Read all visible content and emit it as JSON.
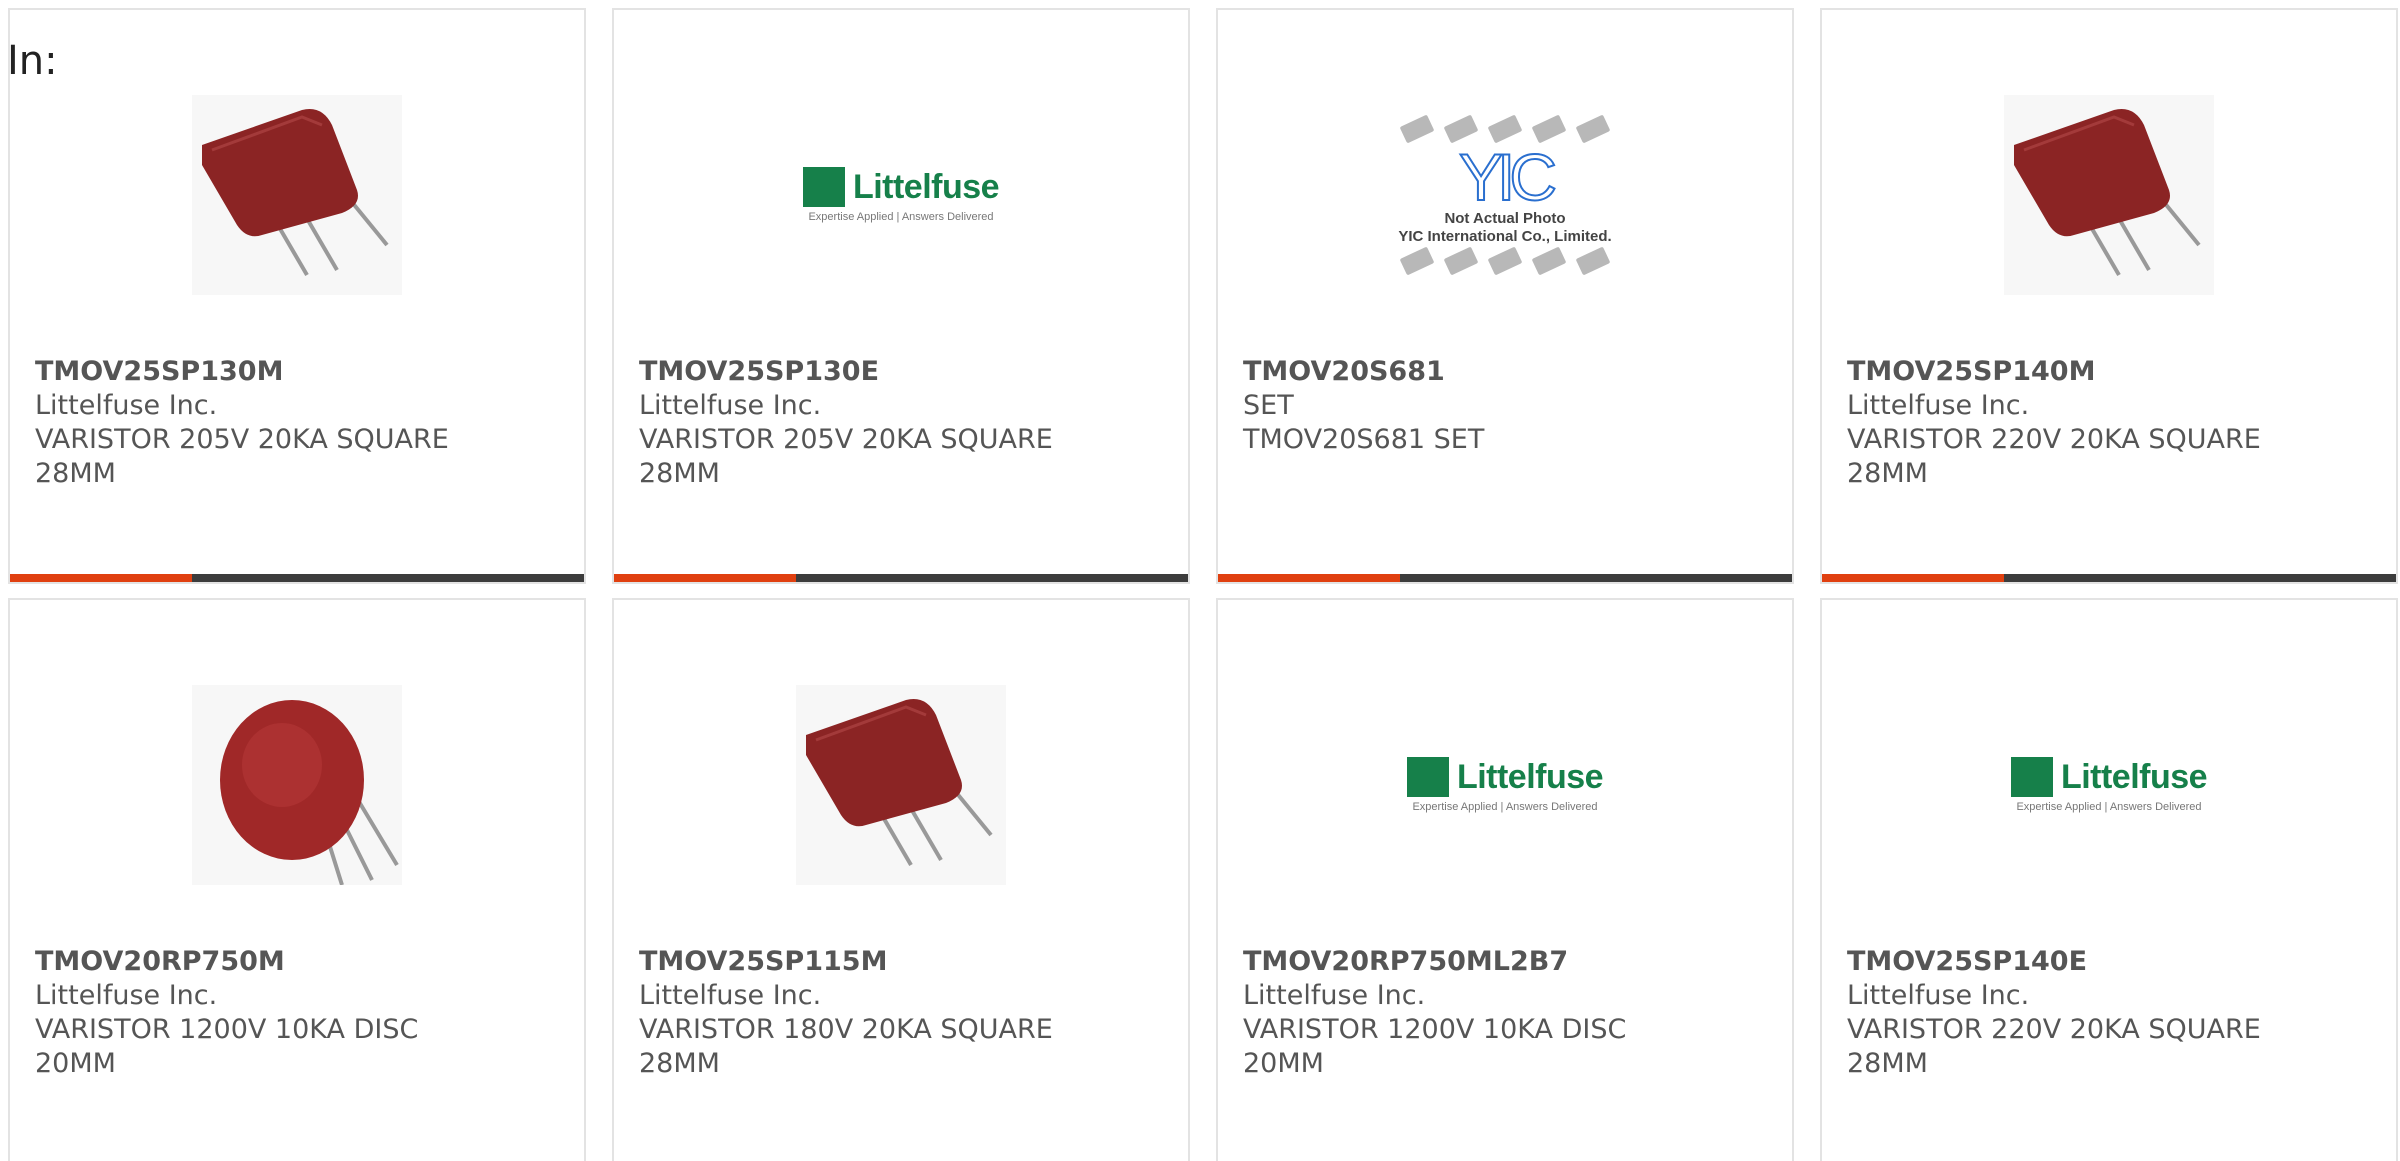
{
  "header": {
    "label": "In:"
  },
  "colors": {
    "accent": "#e04010",
    "bar": "#3c3c3c",
    "brand_green": "#16804a",
    "varistor": "#8b2424"
  },
  "products": [
    {
      "part_number": "TMOV25SP130M",
      "manufacturer": "Littelfuse Inc.",
      "desc_line1": "VARISTOR 205V 20KA SQUARE",
      "desc_line2": "28MM",
      "image": "square-varistor-photo"
    },
    {
      "part_number": "TMOV25SP130E",
      "manufacturer": "Littelfuse Inc.",
      "desc_line1": "VARISTOR 205V 20KA SQUARE",
      "desc_line2": "28MM",
      "image": "littelfuse-logo"
    },
    {
      "part_number": "TMOV20S681",
      "manufacturer": "SET",
      "desc_line1": "TMOV20S681 SET",
      "desc_line2": "",
      "image": "yic-placeholder"
    },
    {
      "part_number": "TMOV25SP140M",
      "manufacturer": "Littelfuse Inc.",
      "desc_line1": "VARISTOR 220V 20KA SQUARE",
      "desc_line2": "28MM",
      "image": "square-varistor-photo"
    },
    {
      "part_number": "TMOV20RP750M",
      "manufacturer": "Littelfuse Inc.",
      "desc_line1": "VARISTOR 1200V 10KA DISC",
      "desc_line2": "20MM",
      "image": "disc-varistor-photo"
    },
    {
      "part_number": "TMOV25SP115M",
      "manufacturer": "Littelfuse Inc.",
      "desc_line1": "VARISTOR 180V 20KA SQUARE",
      "desc_line2": "28MM",
      "image": "square-varistor-photo"
    },
    {
      "part_number": "TMOV20RP750ML2B7",
      "manufacturer": "Littelfuse Inc.",
      "desc_line1": "VARISTOR 1200V 10KA DISC",
      "desc_line2": "20MM",
      "image": "littelfuse-logo"
    },
    {
      "part_number": "TMOV25SP140E",
      "manufacturer": "Littelfuse Inc.",
      "desc_line1": "VARISTOR 220V 20KA SQUARE",
      "desc_line2": "28MM",
      "image": "littelfuse-logo"
    }
  ],
  "littelfuse_logo": {
    "wordmark": "Littelfuse",
    "tagline": "Expertise Applied | Answers Delivered"
  },
  "yic_placeholder": {
    "letters": "YIC",
    "caption_line1": "Not Actual Photo",
    "caption_line2": "YIC International Co., Limited."
  }
}
